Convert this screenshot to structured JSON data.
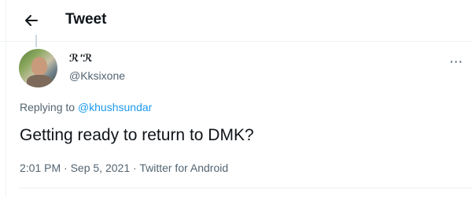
{
  "header": {
    "title": "Tweet",
    "back_icon": "arrow-left-icon"
  },
  "tweet": {
    "author": {
      "display_name": "ℛ'ℛ",
      "handle": "@Kksixone"
    },
    "more_icon": "more-horizontal-icon",
    "more_label": "···",
    "replying": {
      "prefix": "Replying to ",
      "target": "@khushsundar"
    },
    "text": "Getting ready to return to DMK?",
    "meta": {
      "time": "2:01 PM",
      "separator": " · ",
      "date": "Sep 5, 2021",
      "source": "Twitter for Android"
    }
  },
  "colors": {
    "accent": "#1d9bf0",
    "secondary_text": "#536471",
    "primary_text": "#0f1419",
    "divider": "#eff3f4"
  }
}
